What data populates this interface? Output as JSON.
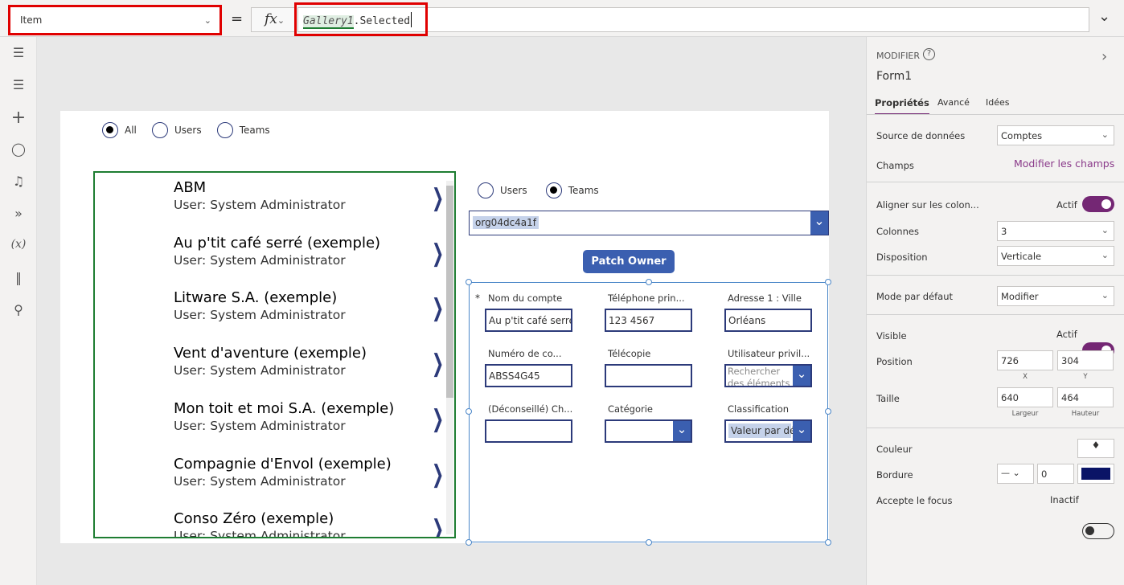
{
  "formula_bar": {
    "property": "Item",
    "equals": "=",
    "fx": "fx",
    "formula_ref": "Gallery1",
    "formula_rest": ".Selected"
  },
  "screen": {
    "filter_radio": {
      "options": [
        "All",
        "Users",
        "Teams"
      ],
      "selected": "All"
    },
    "gallery": {
      "items": [
        {
          "title": "ABM",
          "subtitle": "User: System Administrator"
        },
        {
          "title": "Au p'tit café serré (exemple)",
          "subtitle": "User: System Administrator"
        },
        {
          "title": "Litware S.A. (exemple)",
          "subtitle": "User: System Administrator"
        },
        {
          "title": "Vent d'aventure (exemple)",
          "subtitle": "User: System Administrator"
        },
        {
          "title": "Mon toit et moi S.A. (exemple)",
          "subtitle": "User: System Administrator"
        },
        {
          "title": "Compagnie d'Envol (exemple)",
          "subtitle": "User: System Administrator"
        },
        {
          "title": "Conso Zéro (exemple)",
          "subtitle": "User: System Administrator"
        }
      ]
    },
    "owner_radio": {
      "options": [
        "Users",
        "Teams"
      ],
      "selected": "Teams"
    },
    "owner_dropdown": {
      "value": "org04dc4a1f"
    },
    "patch_button": "Patch Owner",
    "form": {
      "required_mark": "*",
      "fields": [
        {
          "label": "Nom du compte",
          "value": "Au p'tit café serré"
        },
        {
          "label": "Téléphone prin...",
          "value": "123 4567"
        },
        {
          "label": "Adresse 1 : Ville",
          "value": "Orléans"
        },
        {
          "label": "Numéro de co...",
          "value": "ABSS4G45"
        },
        {
          "label": "Télécopie",
          "value": ""
        },
        {
          "label": "Utilisateur privil...",
          "placeholder": "Rechercher des éléments"
        },
        {
          "label": "(Déconseillé) Ch...",
          "value": ""
        },
        {
          "label": "Catégorie",
          "value": ""
        },
        {
          "label": "Classification",
          "value": "Valeur par dé"
        }
      ]
    }
  },
  "panel": {
    "type": "MODIFIER",
    "name": "Form1",
    "tabs": [
      "Propriétés",
      "Avancé",
      "Idées"
    ],
    "active_tab": "Propriétés",
    "source_label": "Source de données",
    "source_value": "Comptes",
    "fields_label": "Champs",
    "fields_link": "Modifier les champs",
    "snap_label": "Aligner sur les colon...",
    "snap_state": "Actif",
    "columns_label": "Colonnes",
    "columns_value": "3",
    "layout_label": "Disposition",
    "layout_value": "Verticale",
    "mode_label": "Mode par défaut",
    "mode_value": "Modifier",
    "visible_label": "Visible",
    "visible_state": "Actif",
    "position_label": "Position",
    "x": "726",
    "y": "304",
    "x_label": "X",
    "y_label": "Y",
    "size_label": "Taille",
    "width": "640",
    "height": "464",
    "width_label": "Largeur",
    "height_label": "Hauteur",
    "color_label": "Couleur",
    "border_label": "Bordure",
    "border_width": "0",
    "border_color": "#0a1466",
    "focus_label": "Accepte le focus",
    "focus_state": "Inactif"
  },
  "colors": {
    "accent": "#742774",
    "button": "#3b5fb0",
    "gallery_border": "#1e7d32",
    "highlight": "#e00000"
  }
}
